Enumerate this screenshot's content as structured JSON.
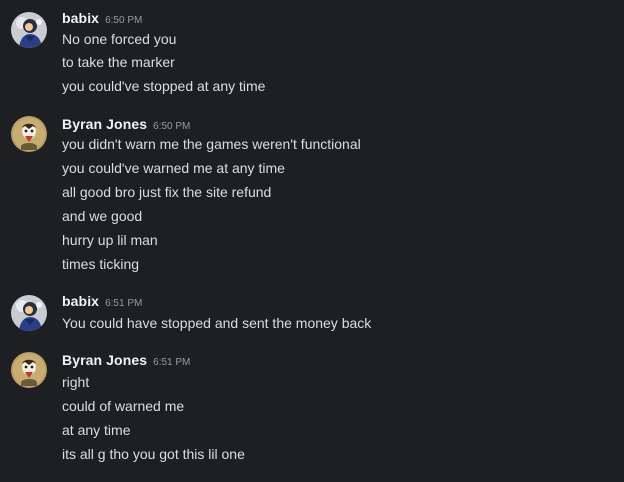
{
  "groups": [
    {
      "author": "babix",
      "time": "6:50 PM",
      "avatar_icon": "user-avatar-babix",
      "lines": [
        "No one forced you",
        "to take the marker",
        "you could've stopped at any time"
      ]
    },
    {
      "author": "Byran Jones",
      "time": "6:50 PM",
      "avatar_icon": "user-avatar-byran",
      "lines": [
        "you didn't warn me the games weren't functional",
        "you could've warned me at any time",
        "all good bro just fix the site refund",
        "and we good",
        "hurry up lil man",
        "times ticking"
      ]
    },
    {
      "author": "babix",
      "time": "6:51 PM",
      "avatar_icon": "user-avatar-babix",
      "lines": [
        "You could have stopped and sent the money back"
      ]
    },
    {
      "author": "Byran Jones",
      "time": "6:51 PM",
      "avatar_icon": "user-avatar-byran",
      "lines": [
        "right",
        "could of warned me",
        "at any time",
        "its all g tho you got this lil one"
      ]
    }
  ],
  "colors": {
    "background": "#1e1f22",
    "author": "#f2f3f5",
    "timestamp": "#949ba4",
    "text": "#dbdee1"
  }
}
